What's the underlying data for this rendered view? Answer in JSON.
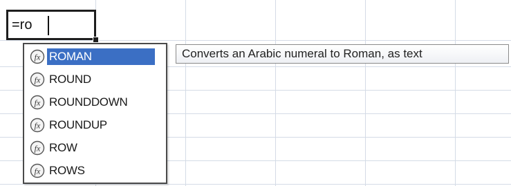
{
  "formula_cell": {
    "text": "=ro"
  },
  "autocomplete": {
    "items": [
      {
        "label": "ROMAN",
        "icon": "function-icon",
        "selected": true
      },
      {
        "label": "ROUND",
        "icon": "function-icon",
        "selected": false
      },
      {
        "label": "ROUNDDOWN",
        "icon": "function-icon",
        "selected": false
      },
      {
        "label": "ROUNDUP",
        "icon": "function-icon",
        "selected": false
      },
      {
        "label": "ROW",
        "icon": "function-icon",
        "selected": false
      },
      {
        "label": "ROWS",
        "icon": "function-icon",
        "selected": false
      }
    ],
    "highlight_color": "#3b6fc4"
  },
  "tooltip": {
    "text": "Converts an Arabic numeral to Roman, as text"
  },
  "colors": {
    "gridline": "#d4dbe6",
    "cell_border": "#1e1e1e"
  }
}
